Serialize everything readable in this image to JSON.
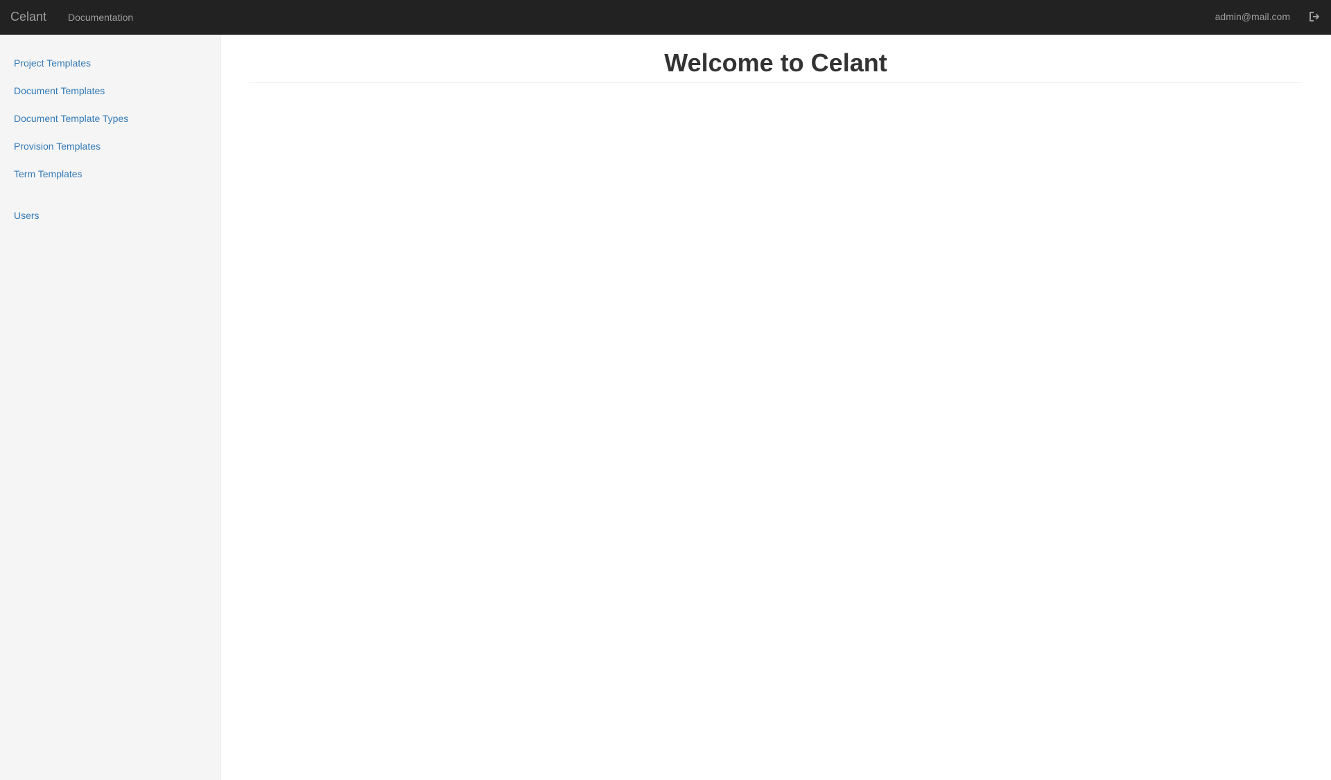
{
  "navbar": {
    "brand": "Celant",
    "links": [
      {
        "label": "Documentation"
      }
    ],
    "user_email": "admin@mail.com",
    "logout_icon": "sign-out-icon",
    "background_color": "#222222",
    "text_color": "#9d9d9d"
  },
  "sidebar": {
    "items": [
      {
        "label": "Project Templates"
      },
      {
        "label": "Document Templates"
      },
      {
        "label": "Document Template Types"
      },
      {
        "label": "Provision Templates"
      },
      {
        "label": "Term Templates"
      },
      {
        "label": "Users"
      }
    ],
    "link_color": "#337ab7",
    "background_color": "#f5f5f5"
  },
  "main": {
    "title": "Welcome to Celant"
  }
}
